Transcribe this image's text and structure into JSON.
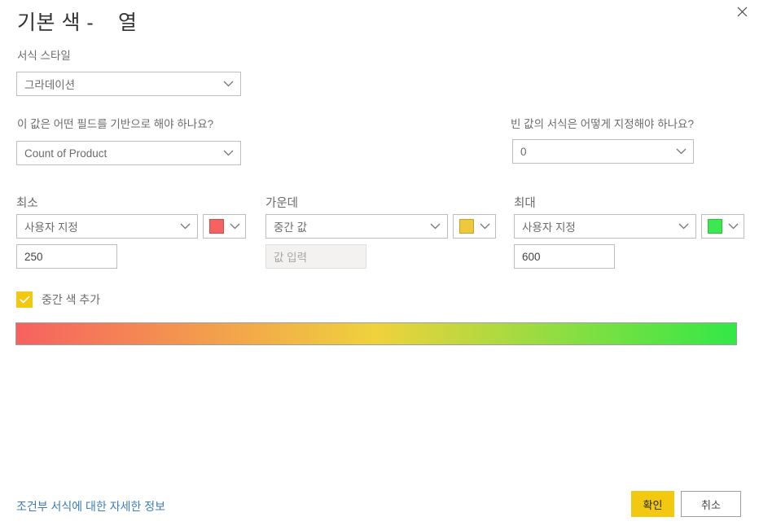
{
  "dialog": {
    "title": "기본 색 -    열",
    "close_icon": "close-icon"
  },
  "format_style": {
    "label": "서식 스타일",
    "value": "그라데이션"
  },
  "basis_field": {
    "label": "이 값은 어떤 필드를 기반으로 해야 하나요?",
    "value": "Count of Product"
  },
  "blank_values": {
    "label": "빈 값의 서식은 어떻게 지정해야 하나요?",
    "value": "0"
  },
  "minimum": {
    "label": "최소",
    "rule": "사용자 지정",
    "color": "#F76160",
    "value": "250"
  },
  "center": {
    "label": "가운데",
    "rule": "중간 값",
    "color": "#EFC93C",
    "value": "",
    "placeholder": "값 입력"
  },
  "maximum": {
    "label": "최대",
    "rule": "사용자 지정",
    "color": "#3BE850",
    "value": "600"
  },
  "add_middle_color": {
    "label": "중간 색 추가",
    "checked": "true",
    "accent": "#F2C811"
  },
  "gradient_preview": {
    "start": "#F76160",
    "middle": "#EFD23C",
    "end": "#32E846"
  },
  "footer": {
    "help_link": "조건부 서식에 대한 자세한 정보",
    "ok_label": "확인",
    "cancel_label": "취소"
  }
}
